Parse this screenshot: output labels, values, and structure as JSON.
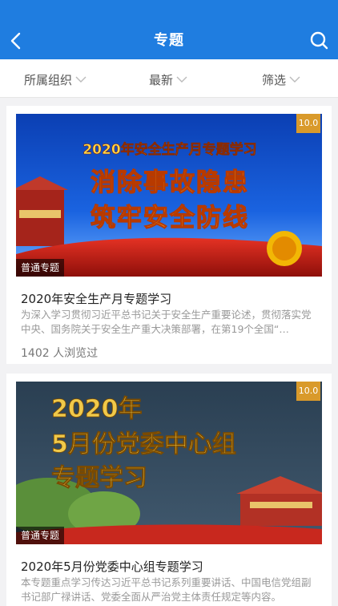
{
  "header": {
    "title": "专题"
  },
  "filters": [
    {
      "label": "所属组织"
    },
    {
      "label": "最新"
    },
    {
      "label": "筛选"
    }
  ],
  "cards": [
    {
      "score": "10.0",
      "badge": "普通专题",
      "banner_caption": "2020年安全生产月专题学习",
      "banner_line1": "消除事故隐患",
      "banner_line2": "筑牢安全防线",
      "title": "2020年安全生产月专题学习",
      "desc": "为深入学习贯彻习近平总书记关于安全生产重要论述，贯彻落实党中央、国务院关于安全生产重大决策部署，在第19个全国“…",
      "views": "1402 人浏览过"
    },
    {
      "score": "10.0",
      "badge": "普通专题",
      "banner_line1": "2020年",
      "banner_line2": "5月份党委中心组",
      "banner_line3": "专题学习",
      "title": "2020年5月份党委中心组专题学习",
      "desc": "本专题重点学习传达习近平总书记系列重要讲话、中国电信党组副书记部广禄讲话、党委全面从严治党主体责任规定等内容。"
    }
  ]
}
